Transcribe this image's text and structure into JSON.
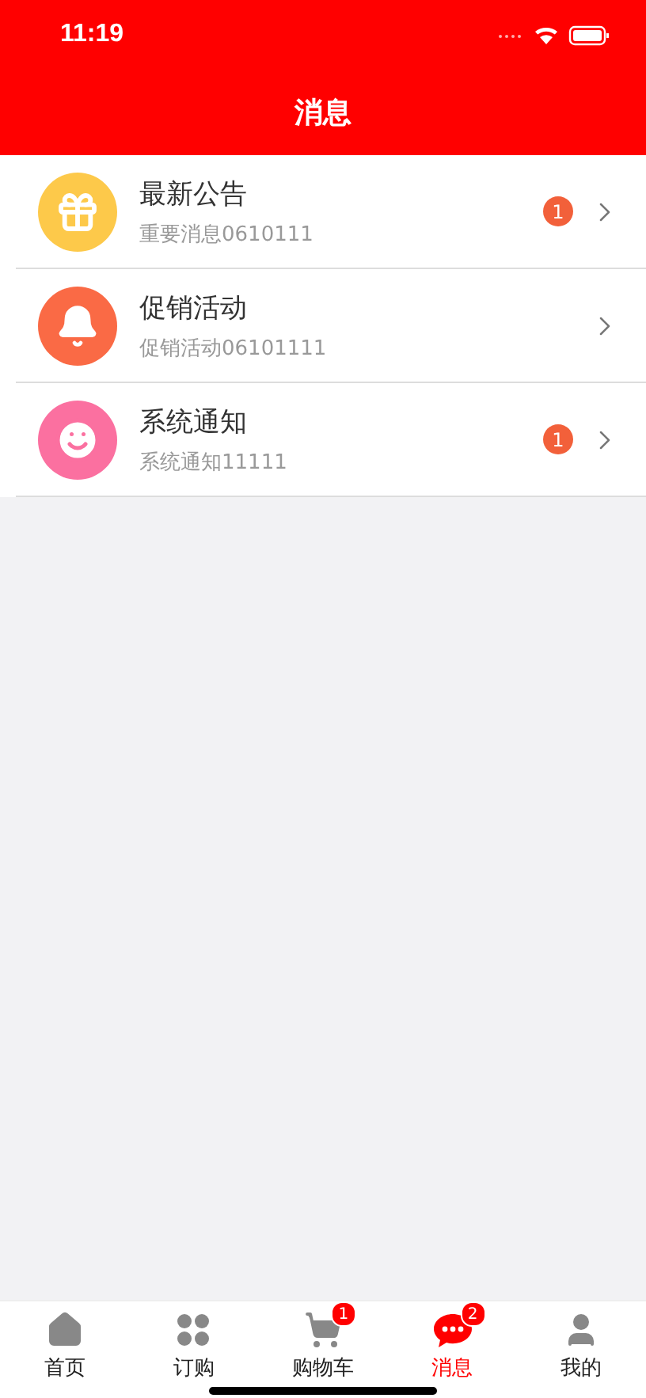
{
  "status_bar": {
    "time": "11:19"
  },
  "header": {
    "title": "消息"
  },
  "messages": [
    {
      "kind": "gift",
      "color": "#fdc94a",
      "title": "最新公告",
      "subtitle": "重要消息0610111",
      "badge": "1"
    },
    {
      "kind": "bell",
      "color": "#fa6a45",
      "title": "促销活动",
      "subtitle": "促销活动06101111"
    },
    {
      "kind": "smile",
      "color": "#fb70a0",
      "title": "系统通知",
      "subtitle": "系统通知11111",
      "badge": "1"
    }
  ],
  "tabs": [
    {
      "kind": "home",
      "label": "首页",
      "selected": false
    },
    {
      "kind": "grid",
      "label": "订购",
      "selected": false
    },
    {
      "kind": "cart",
      "label": "购物车",
      "selected": false,
      "badge": "1"
    },
    {
      "kind": "chat",
      "label": "消息",
      "selected": true,
      "badge": "2"
    },
    {
      "kind": "user",
      "label": "我的",
      "selected": false
    }
  ]
}
